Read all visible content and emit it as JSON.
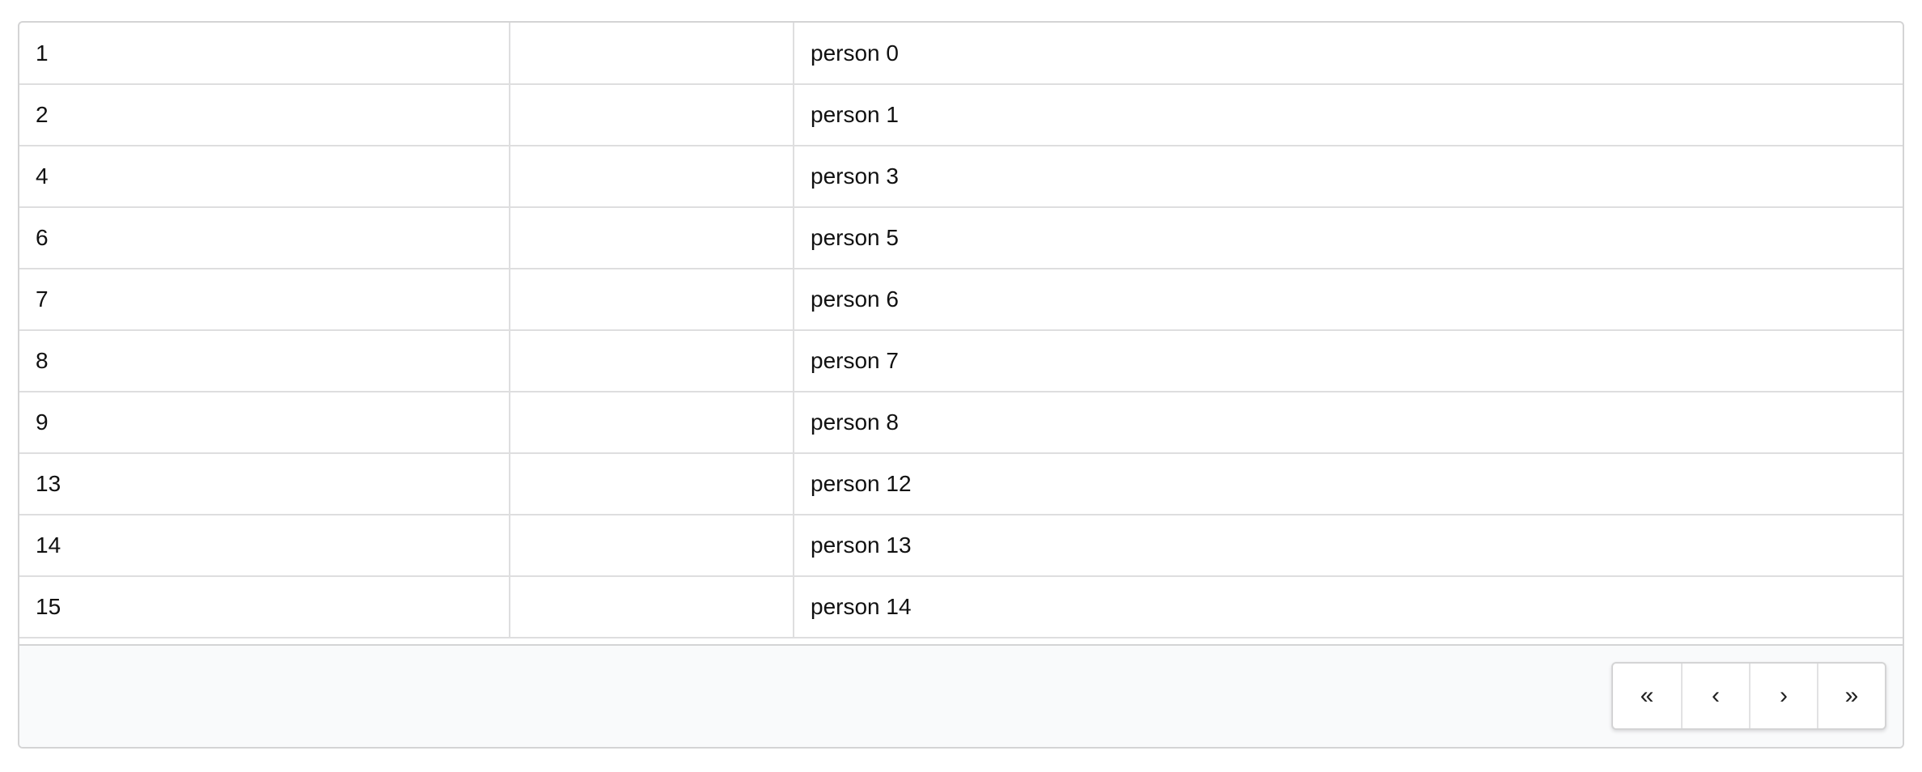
{
  "table": {
    "rows": [
      {
        "id": "1",
        "middle": "",
        "name": "person 0"
      },
      {
        "id": "2",
        "middle": "",
        "name": "person 1"
      },
      {
        "id": "4",
        "middle": "",
        "name": "person 3"
      },
      {
        "id": "6",
        "middle": "",
        "name": "person 5"
      },
      {
        "id": "7",
        "middle": "",
        "name": "person 6"
      },
      {
        "id": "8",
        "middle": "",
        "name": "person 7"
      },
      {
        "id": "9",
        "middle": "",
        "name": "person 8"
      },
      {
        "id": "13",
        "middle": "",
        "name": "person 12"
      },
      {
        "id": "14",
        "middle": "",
        "name": "person 13"
      },
      {
        "id": "15",
        "middle": "",
        "name": "person 14"
      }
    ]
  },
  "pagination": {
    "first": "«",
    "prev": "‹",
    "next": "›",
    "last": "»",
    "icons": [
      "double-chevron-left-icon",
      "chevron-left-icon",
      "chevron-right-icon",
      "double-chevron-right-icon"
    ]
  },
  "colors": {
    "border": "#d4d4d5",
    "row_divider": "#dededf",
    "footer_bg": "#f9fafb"
  }
}
